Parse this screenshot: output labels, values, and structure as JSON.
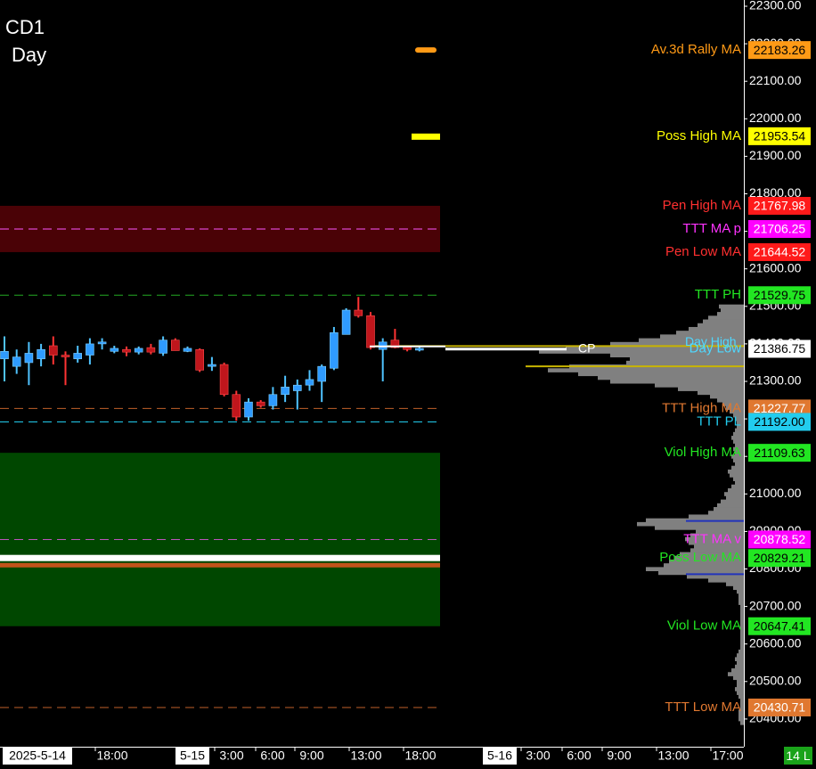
{
  "header": {
    "symbol": "CD1",
    "period": "Day"
  },
  "badge": {
    "label": "14 L"
  },
  "colors": {
    "background": "#000000",
    "up_candle": "#2f9bff",
    "down_candle": "#c0161c",
    "wick_up": "#4fc3ff",
    "profile": "#808080",
    "axis_text": "#ffffff"
  },
  "chart_data": {
    "type": "candlestick",
    "title": "",
    "y_axis": {
      "range": [
        20380,
        22320
      ],
      "ticks": [
        22300,
        22200,
        22100,
        22000,
        21900,
        21800,
        21700,
        21600,
        21500,
        21400,
        21300,
        21200,
        21100,
        21000,
        20900,
        20800,
        20700,
        20600,
        20500,
        20400
      ],
      "tick_labels": [
        "22300.00",
        "22200.00",
        "22100.00",
        "22000.00",
        "21900.00",
        "21800.00",
        "21700.00",
        "21600.00",
        "21500.00",
        "21400.00",
        "21300.00",
        "21200.00",
        "21100.00",
        "21000.00",
        "20900.00",
        "20800.00",
        "20700.00",
        "20600.00",
        "20500.00",
        "20400.00"
      ]
    },
    "x_axis": {
      "labels": [
        {
          "text": "2025-5-14",
          "boxed": true
        },
        {
          "text": "18:00",
          "boxed": false
        },
        {
          "text": "5-15",
          "boxed": true
        },
        {
          "text": "3:00",
          "boxed": false
        },
        {
          "text": "6:00",
          "boxed": false
        },
        {
          "text": "9:00",
          "boxed": false
        },
        {
          "text": "13:00",
          "boxed": false
        },
        {
          "text": "18:00",
          "boxed": false
        },
        {
          "text": "5-16",
          "boxed": true
        },
        {
          "text": "3:00",
          "boxed": false
        },
        {
          "text": "6:00",
          "boxed": false
        },
        {
          "text": "9:00",
          "boxed": false
        },
        {
          "text": "13:00",
          "boxed": false
        },
        {
          "text": "17:00",
          "boxed": false
        }
      ]
    },
    "zones": [
      {
        "name": "pen-zone",
        "from": 21644.52,
        "to": 21767.98,
        "color": "#4a0206"
      },
      {
        "name": "viol-zone",
        "from": 20647.41,
        "to": 21109.63,
        "color": "#004700"
      }
    ],
    "candles": [
      {
        "o": 21360,
        "h": 21420,
        "l": 21300,
        "c": 21380
      },
      {
        "o": 21340,
        "h": 21385,
        "l": 21320,
        "c": 21365
      },
      {
        "o": 21350,
        "h": 21405,
        "l": 21290,
        "c": 21375
      },
      {
        "o": 21360,
        "h": 21400,
        "l": 21340,
        "c": 21385
      },
      {
        "o": 21395,
        "h": 21420,
        "l": 21345,
        "c": 21370
      },
      {
        "o": 21370,
        "h": 21380,
        "l": 21290,
        "c": 21368
      },
      {
        "o": 21360,
        "h": 21395,
        "l": 21350,
        "c": 21375
      },
      {
        "o": 21370,
        "h": 21415,
        "l": 21345,
        "c": 21400
      },
      {
        "o": 21400,
        "h": 21415,
        "l": 21385,
        "c": 21405
      },
      {
        "o": 21380,
        "h": 21395,
        "l": 21375,
        "c": 21388
      },
      {
        "o": 21385,
        "h": 21393,
        "l": 21367,
        "c": 21378
      },
      {
        "o": 21378,
        "h": 21393,
        "l": 21372,
        "c": 21388
      },
      {
        "o": 21390,
        "h": 21400,
        "l": 21372,
        "c": 21378
      },
      {
        "o": 21375,
        "h": 21420,
        "l": 21368,
        "c": 21410
      },
      {
        "o": 21410,
        "h": 21415,
        "l": 21382,
        "c": 21382
      },
      {
        "o": 21380,
        "h": 21393,
        "l": 21378,
        "c": 21388
      },
      {
        "o": 21385,
        "h": 21388,
        "l": 21325,
        "c": 21330
      },
      {
        "o": 21340,
        "h": 21365,
        "l": 21328,
        "c": 21345
      },
      {
        "o": 21345,
        "h": 21350,
        "l": 21260,
        "c": 21265
      },
      {
        "o": 21265,
        "h": 21275,
        "l": 21195,
        "c": 21205
      },
      {
        "o": 21205,
        "h": 21255,
        "l": 21195,
        "c": 21245
      },
      {
        "o": 21245,
        "h": 21250,
        "l": 21230,
        "c": 21235
      },
      {
        "o": 21235,
        "h": 21285,
        "l": 21225,
        "c": 21265
      },
      {
        "o": 21265,
        "h": 21315,
        "l": 21245,
        "c": 21285
      },
      {
        "o": 21275,
        "h": 21305,
        "l": 21225,
        "c": 21290
      },
      {
        "o": 21290,
        "h": 21330,
        "l": 21275,
        "c": 21305
      },
      {
        "o": 21300,
        "h": 21345,
        "l": 21245,
        "c": 21340
      },
      {
        "o": 21335,
        "h": 21445,
        "l": 21330,
        "c": 21430
      },
      {
        "o": 21425,
        "h": 21495,
        "l": 21430,
        "c": 21490
      },
      {
        "o": 21490,
        "h": 21525,
        "l": 21470,
        "c": 21475
      },
      {
        "o": 21475,
        "h": 21485,
        "l": 21385,
        "c": 21390
      },
      {
        "o": 21385,
        "h": 21415,
        "l": 21300,
        "c": 21405
      },
      {
        "o": 21410,
        "h": 21440,
        "l": 21388,
        "c": 21390
      },
      {
        "o": 21392,
        "h": 21395,
        "l": 21380,
        "c": 21385
      },
      {
        "o": 21385,
        "h": 21392,
        "l": 21380,
        "c": 21388
      }
    ],
    "levels": [
      {
        "label": "Av.3d Rally MA",
        "value": 22183.26,
        "value_text": "22183.26",
        "color": "#ff9a16",
        "text_color": "#ff9a16",
        "line": "none",
        "line_color": "#ff9a16"
      },
      {
        "label": "Poss High MA",
        "value": 21953.54,
        "value_text": "21953.54",
        "color": "#ffff00",
        "text_color": "#ffff00",
        "line": "none",
        "line_color": "#ffff00"
      },
      {
        "label": "Pen High MA",
        "value": 21767.98,
        "value_text": "21767.98",
        "color": "#ff1a1a",
        "text_color": "#ff3030",
        "line": "none",
        "line_color": "#ff1a1a"
      },
      {
        "label": "TTT MA p",
        "value": 21706.25,
        "value_text": "21706.25",
        "color": "#ff00ff",
        "text_color": "#ff33ff",
        "line": "dash",
        "line_color": "#ff55ff"
      },
      {
        "label": "Pen Low MA",
        "value": 21644.52,
        "value_text": "21644.52",
        "color": "#ff1a1a",
        "text_color": "#ff3030",
        "line": "none",
        "line_color": "#ff1a1a"
      },
      {
        "label": "TTT PH",
        "value": 21529.75,
        "value_text": "21529.75",
        "color": "#22e622",
        "text_color": "#22e622",
        "line": "dash",
        "line_color": "#22aa22"
      },
      {
        "label": "Day Low",
        "value": 21386.75,
        "value_text": "21386.75",
        "color": "#ffffff",
        "text_color": "#4fd8ff",
        "line": "none",
        "line_color": "#ffffff"
      },
      {
        "label": "TTT High MA",
        "value": 21227.77,
        "value_text": "21227.77",
        "color": "#e07830",
        "text_color": "#e07830",
        "line": "dash",
        "line_color": "#c0602a"
      },
      {
        "label": "TTT PL",
        "value": 21192.0,
        "value_text": "21192.00",
        "color": "#22ccee",
        "text_color": "#22ccee",
        "line": "dash",
        "line_color": "#22ccee"
      },
      {
        "label": "Viol High MA",
        "value": 21109.63,
        "value_text": "21109.63",
        "color": "#22e622",
        "text_color": "#22e622",
        "line": "none",
        "line_color": "#22e622"
      },
      {
        "label": "TTT MA v",
        "value": 20878.52,
        "value_text": "20878.52",
        "color": "#ff00ff",
        "text_color": "#ff33ff",
        "line": "dash",
        "line_color": "#bb55bb"
      },
      {
        "label": "Poss Low MA",
        "value": 20829.21,
        "value_text": "20829.21",
        "color": "#22e622",
        "text_color": "#22e622",
        "line": "none",
        "line_color": "#22e622"
      },
      {
        "label": "Viol Low MA",
        "value": 20647.41,
        "value_text": "20647.41",
        "color": "#22e622",
        "text_color": "#22e622",
        "line": "none",
        "line_color": "#22e622"
      },
      {
        "label": "TTT Low MA",
        "value": 20430.71,
        "value_text": "20430.71",
        "color": "#e07830",
        "text_color": "#e07830",
        "line": "dash",
        "line_color": "#c0602a"
      }
    ],
    "overlay_labels": [
      {
        "text": "CP",
        "value": 21386,
        "color": "#ffffff"
      },
      {
        "text": "Day High",
        "value": 21404,
        "color": "#4fd8ff"
      }
    ],
    "bands": [
      {
        "value": 20829.21,
        "thickness": 7,
        "color": "#ffffff"
      },
      {
        "value": 20810,
        "thickness": 5,
        "color": "#c2531a"
      }
    ],
    "markers": [
      {
        "value": 22183.26,
        "color": "#ff9a16",
        "shape": "pill"
      },
      {
        "value": 21953.54,
        "color": "#ffff00",
        "shape": "bar"
      }
    ],
    "horizontal_lines": [
      {
        "value": 21340,
        "color": "#c8b400"
      },
      {
        "value": 21394,
        "color": "#c8b400"
      },
      {
        "value": 20928,
        "color": "#2233bb"
      },
      {
        "value": 20786,
        "color": "#2233bb"
      }
    ],
    "volume_profile": [
      {
        "price": 21500,
        "w": 28
      },
      {
        "price": 21490,
        "w": 26
      },
      {
        "price": 21480,
        "w": 30
      },
      {
        "price": 21470,
        "w": 40
      },
      {
        "price": 21460,
        "w": 46
      },
      {
        "price": 21450,
        "w": 52
      },
      {
        "price": 21440,
        "w": 62
      },
      {
        "price": 21430,
        "w": 76
      },
      {
        "price": 21420,
        "w": 94
      },
      {
        "price": 21410,
        "w": 118
      },
      {
        "price": 21400,
        "w": 150
      },
      {
        "price": 21390,
        "w": 200
      },
      {
        "price": 21380,
        "w": 230
      },
      {
        "price": 21370,
        "w": 150
      },
      {
        "price": 21360,
        "w": 128
      },
      {
        "price": 21350,
        "w": 132
      },
      {
        "price": 21340,
        "w": 196
      },
      {
        "price": 21330,
        "w": 220
      },
      {
        "price": 21320,
        "w": 186
      },
      {
        "price": 21310,
        "w": 164
      },
      {
        "price": 21300,
        "w": 150
      },
      {
        "price": 21290,
        "w": 100
      },
      {
        "price": 21280,
        "w": 74
      },
      {
        "price": 21270,
        "w": 52
      },
      {
        "price": 21260,
        "w": 38
      },
      {
        "price": 21250,
        "w": 30
      },
      {
        "price": 21240,
        "w": 24
      },
      {
        "price": 21230,
        "w": 20
      },
      {
        "price": 21220,
        "w": 16
      },
      {
        "price": 21210,
        "w": 12
      },
      {
        "price": 21200,
        "w": 10
      },
      {
        "price": 21190,
        "w": 8
      },
      {
        "price": 21180,
        "w": 8
      },
      {
        "price": 21170,
        "w": 10
      },
      {
        "price": 21160,
        "w": 12
      },
      {
        "price": 21150,
        "w": 14
      },
      {
        "price": 21140,
        "w": 12
      },
      {
        "price": 21130,
        "w": 10
      },
      {
        "price": 21120,
        "w": 12
      },
      {
        "price": 21110,
        "w": 10
      },
      {
        "price": 21100,
        "w": 14
      },
      {
        "price": 21090,
        "w": 12
      },
      {
        "price": 21080,
        "w": 10
      },
      {
        "price": 21070,
        "w": 14
      },
      {
        "price": 21060,
        "w": 18
      },
      {
        "price": 21050,
        "w": 16
      },
      {
        "price": 21040,
        "w": 12
      },
      {
        "price": 21030,
        "w": 10
      },
      {
        "price": 21020,
        "w": 14
      },
      {
        "price": 21010,
        "w": 18
      },
      {
        "price": 21000,
        "w": 22
      },
      {
        "price": 20990,
        "w": 20
      },
      {
        "price": 20980,
        "w": 26
      },
      {
        "price": 20970,
        "w": 30
      },
      {
        "price": 20960,
        "w": 34
      },
      {
        "price": 20950,
        "w": 40
      },
      {
        "price": 20940,
        "w": 62
      },
      {
        "price": 20930,
        "w": 110
      },
      {
        "price": 20920,
        "w": 120
      },
      {
        "price": 20910,
        "w": 100
      },
      {
        "price": 20900,
        "w": 54
      },
      {
        "price": 20890,
        "w": 60
      },
      {
        "price": 20880,
        "w": 66
      },
      {
        "price": 20870,
        "w": 62
      },
      {
        "price": 20860,
        "w": 56
      },
      {
        "price": 20850,
        "w": 60
      },
      {
        "price": 20840,
        "w": 72
      },
      {
        "price": 20830,
        "w": 78
      },
      {
        "price": 20820,
        "w": 84
      },
      {
        "price": 20810,
        "w": 90
      },
      {
        "price": 20800,
        "w": 110
      },
      {
        "price": 20790,
        "w": 96
      },
      {
        "price": 20780,
        "w": 64
      },
      {
        "price": 20770,
        "w": 40
      },
      {
        "price": 20760,
        "w": 20
      },
      {
        "price": 20750,
        "w": 12
      },
      {
        "price": 20740,
        "w": 8
      },
      {
        "price": 20730,
        "w": 6
      },
      {
        "price": 20720,
        "w": 6
      },
      {
        "price": 20710,
        "w": 6
      },
      {
        "price": 20700,
        "w": 4
      },
      {
        "price": 20690,
        "w": 4
      },
      {
        "price": 20680,
        "w": 4
      },
      {
        "price": 20670,
        "w": 4
      },
      {
        "price": 20660,
        "w": 4
      },
      {
        "price": 20650,
        "w": 4
      },
      {
        "price": 20640,
        "w": 4
      },
      {
        "price": 20630,
        "w": 4
      },
      {
        "price": 20620,
        "w": 4
      },
      {
        "price": 20610,
        "w": 4
      },
      {
        "price": 20600,
        "w": 4
      },
      {
        "price": 20590,
        "w": 4
      },
      {
        "price": 20580,
        "w": 6
      },
      {
        "price": 20570,
        "w": 8
      },
      {
        "price": 20560,
        "w": 10
      },
      {
        "price": 20550,
        "w": 8
      },
      {
        "price": 20540,
        "w": 10
      },
      {
        "price": 20530,
        "w": 14
      },
      {
        "price": 20520,
        "w": 18
      },
      {
        "price": 20510,
        "w": 12
      },
      {
        "price": 20500,
        "w": 8
      },
      {
        "price": 20490,
        "w": 8
      },
      {
        "price": 20480,
        "w": 10
      },
      {
        "price": 20470,
        "w": 8
      },
      {
        "price": 20460,
        "w": 6
      },
      {
        "price": 20450,
        "w": 4
      },
      {
        "price": 20440,
        "w": 4
      },
      {
        "price": 20430,
        "w": 4
      },
      {
        "price": 20420,
        "w": 6
      },
      {
        "price": 20410,
        "w": 6
      },
      {
        "price": 20400,
        "w": 6
      },
      {
        "price": 20390,
        "w": 4
      }
    ]
  }
}
